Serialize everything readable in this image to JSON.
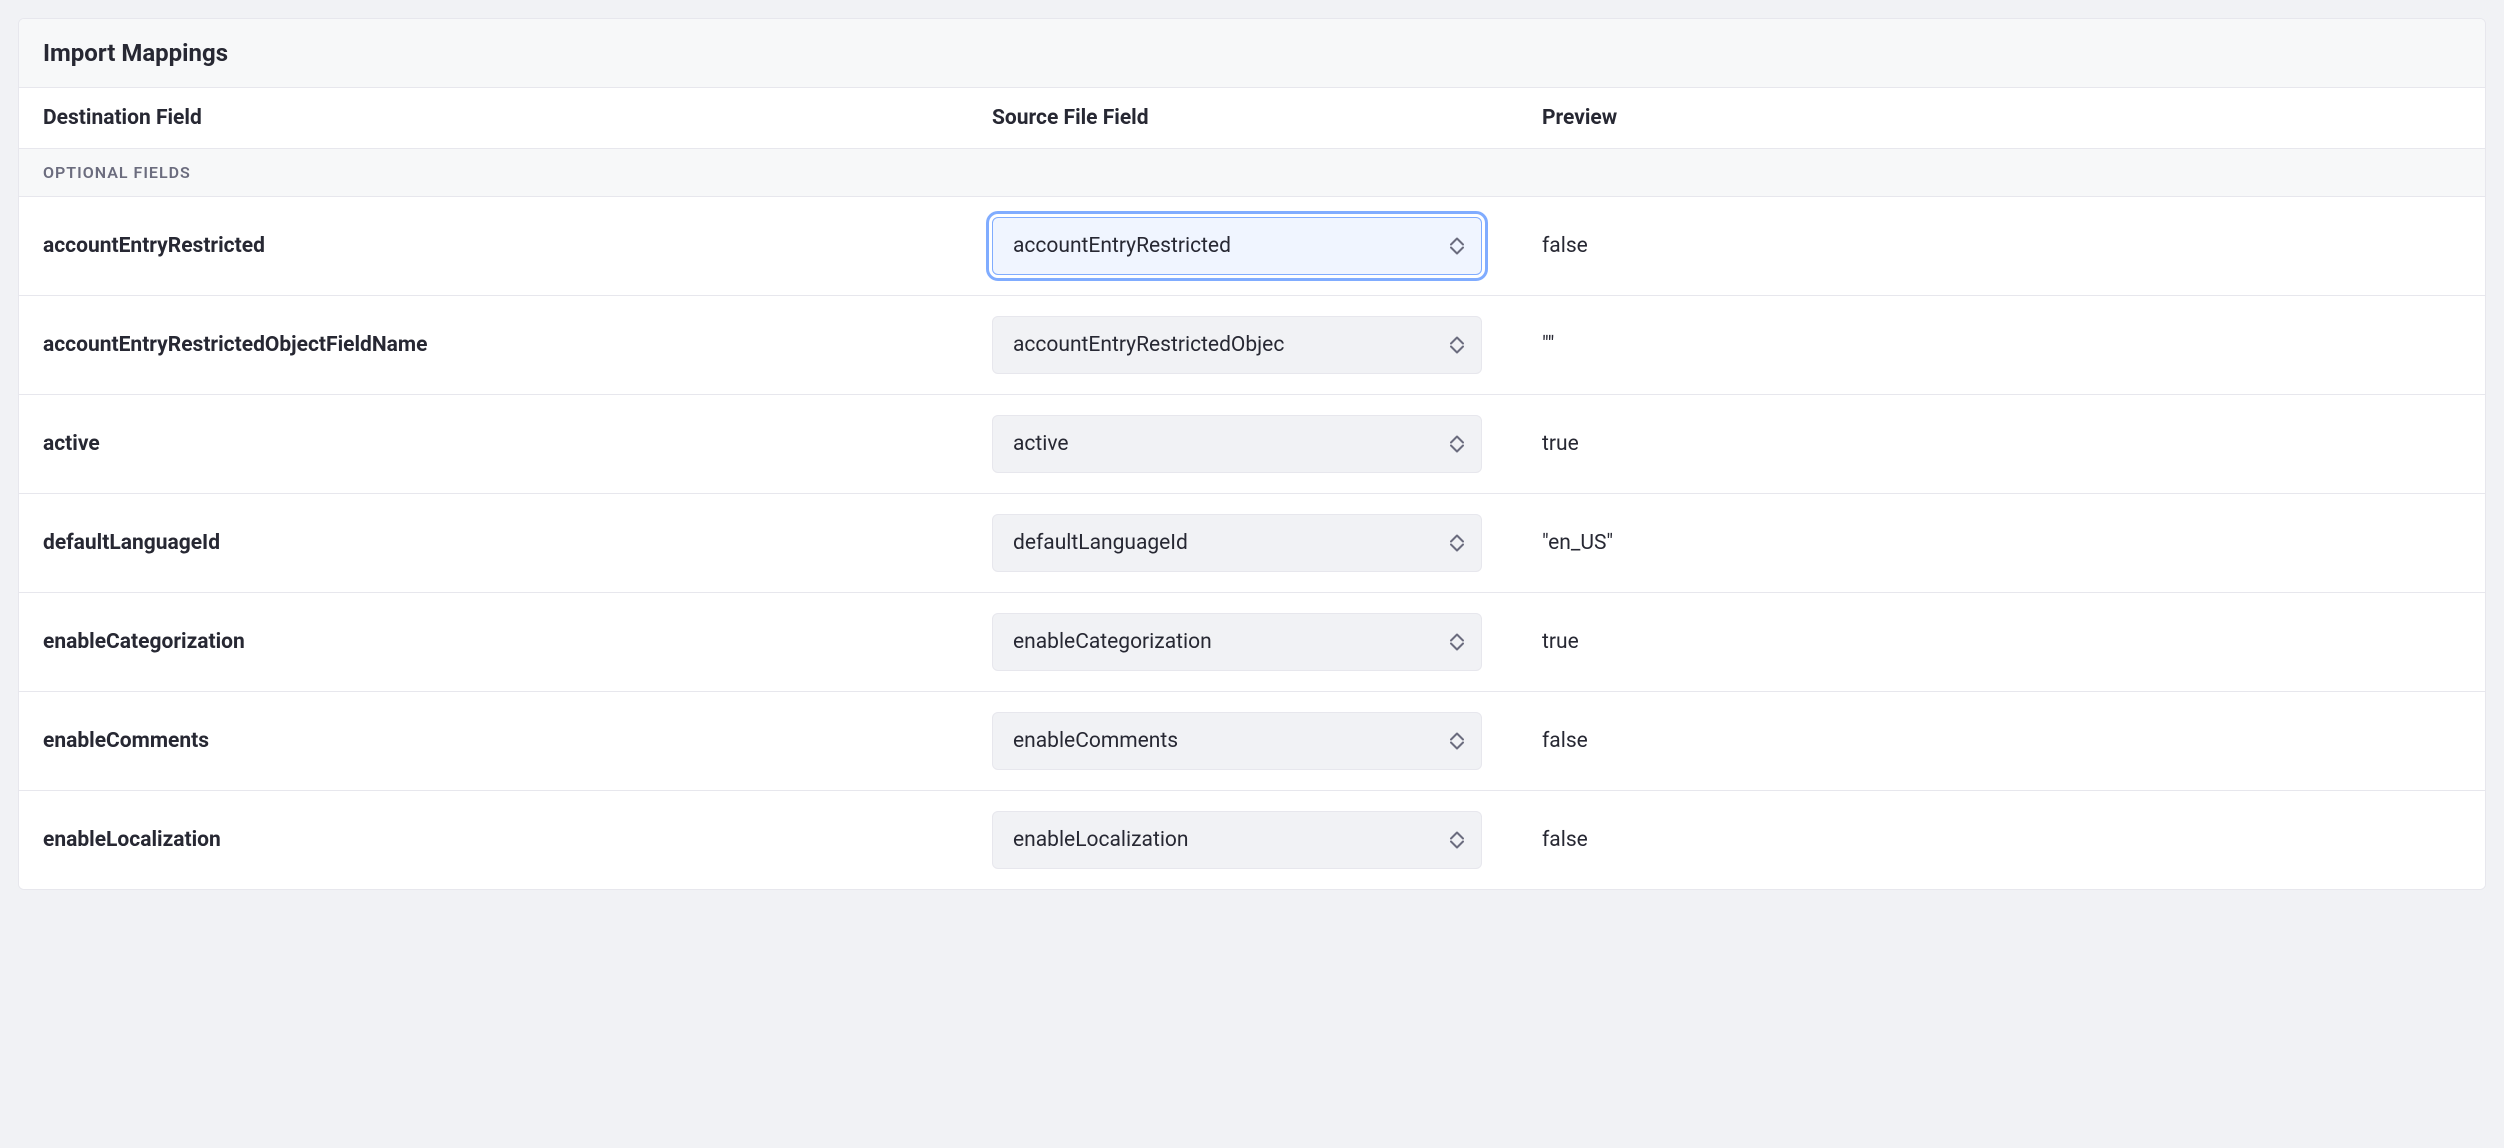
{
  "header": {
    "title": "Import Mappings"
  },
  "columns": {
    "destination": "Destination Field",
    "source": "Source File Field",
    "preview": "Preview"
  },
  "section_label": "OPTIONAL FIELDS",
  "rows": [
    {
      "destination": "accountEntryRestricted",
      "source": "accountEntryRestricted",
      "preview": "false",
      "focused": true
    },
    {
      "destination": "accountEntryRestrictedObjectFieldName",
      "source": "accountEntryRestrictedObjec",
      "preview": "\"\"",
      "focused": false
    },
    {
      "destination": "active",
      "source": "active",
      "preview": "true",
      "focused": false
    },
    {
      "destination": "defaultLanguageId",
      "source": "defaultLanguageId",
      "preview": "\"en_US\"",
      "focused": false
    },
    {
      "destination": "enableCategorization",
      "source": "enableCategorization",
      "preview": "true",
      "focused": false
    },
    {
      "destination": "enableComments",
      "source": "enableComments",
      "preview": "false",
      "focused": false
    },
    {
      "destination": "enableLocalization",
      "source": "enableLocalization",
      "preview": "false",
      "focused": false
    }
  ]
}
